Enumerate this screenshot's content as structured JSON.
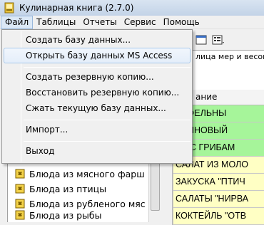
{
  "window": {
    "title": "Кулинарная книга (2.7.0)"
  },
  "menubar": {
    "items": [
      "Файл",
      "Таблицы",
      "Отчеты",
      "Сервис",
      "Помощь"
    ]
  },
  "file_menu": {
    "items": [
      {
        "label": "Создать базу данных..."
      },
      {
        "label": "Открыть базу данных MS Access"
      },
      {
        "label": "Создать резервную копию..."
      },
      {
        "label": "Восстановить резервную копию..."
      },
      {
        "label": "Сжать текущую базу данных..."
      },
      {
        "label": "Импорт..."
      },
      {
        "label": "Выход"
      }
    ]
  },
  "tabs": {
    "active": "лица мер и весов"
  },
  "tree": {
    "items": [
      "Блюда из мясного фарш",
      "Блюда из птицы",
      "Блюда из рубленого мяс",
      "Блюда из рыбы"
    ]
  },
  "grid": {
    "header": "ание",
    "rows": [
      {
        "text": "ТОФЕЛЬНЫ",
        "color": "#a6f59a"
      },
      {
        "text": "ЬСИНОВЫЙ",
        "color": "#a6f59a"
      },
      {
        "text": "ОГ С ГРИБАМ",
        "color": "#a6f59a"
      },
      {
        "text": "САЛАТ ИЗ МОЛО",
        "color": "#ffffc4"
      },
      {
        "text": "ЗАКУСКА \"ПТИЧ",
        "color": "#ffffc4"
      },
      {
        "text": "САЛАТЫ \"НИРВА",
        "color": "#ffffc4"
      },
      {
        "text": "КОКТЕЙЛЬ \"ОТВ",
        "color": "#ffffc4"
      }
    ]
  }
}
